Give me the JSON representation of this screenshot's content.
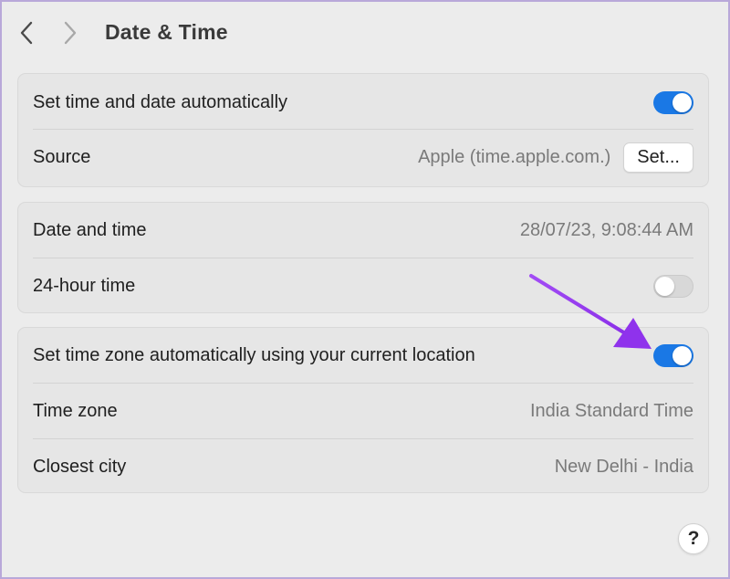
{
  "window": {
    "title": "Date & Time",
    "back_icon": "chevron-left-icon",
    "forward_icon": "chevron-right-icon"
  },
  "groups": [
    {
      "rows": [
        {
          "label": "Set time and date automatically",
          "control": "toggle",
          "toggle_on": true
        },
        {
          "label": "Source",
          "value": "Apple (time.apple.com.)",
          "button_label": "Set..."
        }
      ]
    },
    {
      "rows": [
        {
          "label": "Date and time",
          "value": "28/07/23, 9:08:44 AM"
        },
        {
          "label": "24-hour time",
          "control": "toggle",
          "toggle_on": false
        }
      ]
    },
    {
      "rows": [
        {
          "label": "Set time zone automatically using your current location",
          "control": "toggle",
          "toggle_on": true
        },
        {
          "label": "Time zone",
          "value": "India Standard Time"
        },
        {
          "label": "Closest city",
          "value": "New Delhi - India"
        }
      ]
    }
  ],
  "help": {
    "label": "?"
  },
  "colors": {
    "accent": "#1a78e5",
    "annotation_arrow": "#9b3bf0"
  }
}
